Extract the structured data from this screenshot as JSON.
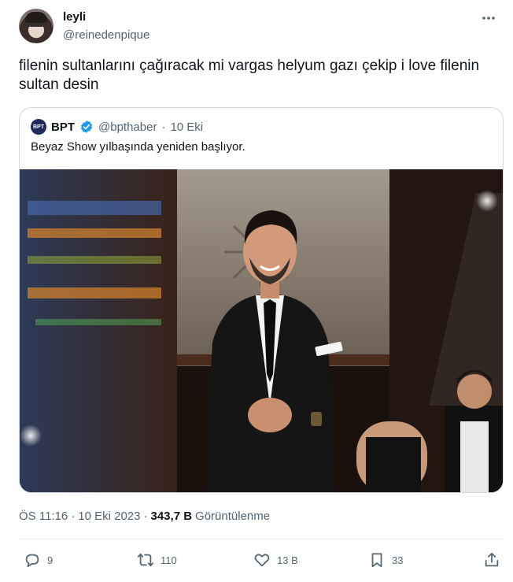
{
  "author": {
    "name": "leyli",
    "handle": "@reinedenpique"
  },
  "tweet": {
    "text": "filenin sultanlarını çağıracak mi vargas helyum gazı çekip i love filenin sultan desin"
  },
  "quoted": {
    "logo_text": "BPT",
    "name": "BPT",
    "handle": "@bpthaber",
    "separator": "·",
    "date": "10 Eki",
    "text": "Beyaz Show yılbaşında yeniden başlıyor."
  },
  "meta": {
    "time": "ÖS 11:16",
    "separator": "·",
    "date": "10 Eki 2023",
    "separator2": "·",
    "views": "343,7 B",
    "views_label": "Görüntülenme"
  },
  "actions": {
    "replies": "9",
    "reposts": "110",
    "likes": "13 B",
    "bookmarks": "33"
  },
  "colors": {
    "text": "#0f1419",
    "muted": "#536471",
    "verified": "#1d9bf0",
    "border": "#cfd9de"
  },
  "icons": [
    "more-icon",
    "verified-icon",
    "reply-icon",
    "repost-icon",
    "like-icon",
    "bookmark-icon",
    "share-icon"
  ]
}
